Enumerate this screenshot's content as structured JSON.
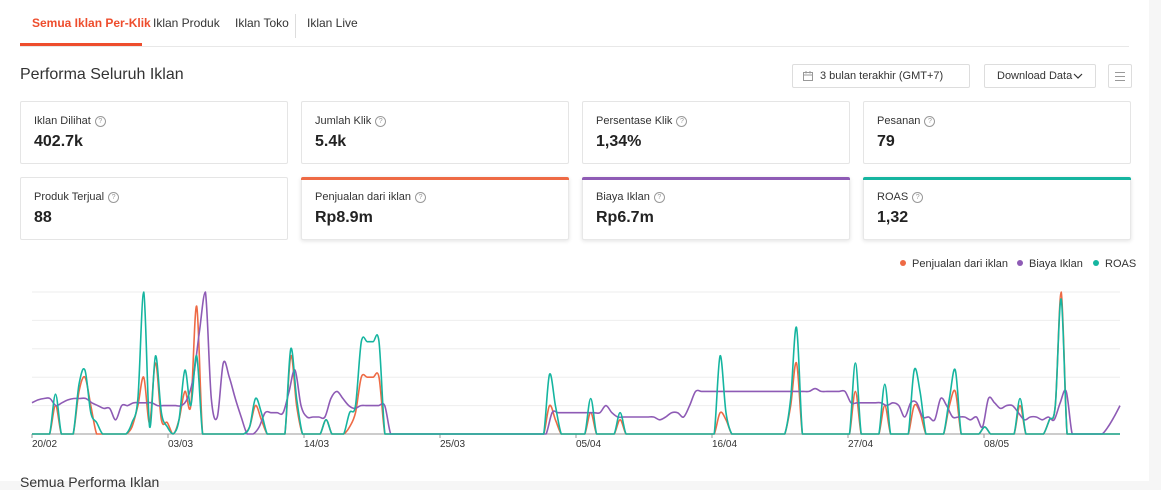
{
  "tabs": [
    {
      "label": "Semua Iklan Per-Klik",
      "active": true
    },
    {
      "label": "Iklan Produk",
      "active": false
    },
    {
      "label": "Iklan Toko",
      "active": false
    },
    {
      "label": "Iklan Live",
      "active": false
    }
  ],
  "header": {
    "title": "Performa Seluruh Iklan",
    "date_range": "3 bulan terakhir (GMT+7)",
    "download_label": "Download Data"
  },
  "metrics": [
    {
      "label": "Iklan Dilihat",
      "value": "402.7k",
      "selected": false
    },
    {
      "label": "Jumlah Klik",
      "value": "5.4k",
      "selected": false
    },
    {
      "label": "Persentase Klik",
      "value": "1,34%",
      "selected": false
    },
    {
      "label": "Pesanan",
      "value": "79",
      "selected": false
    },
    {
      "label": "Produk Terjual",
      "value": "88",
      "selected": false
    },
    {
      "label": "Penjualan dari iklan",
      "value": "Rp8.9m",
      "selected": true,
      "color": "#ee6a45"
    },
    {
      "label": "Biaya Iklan",
      "value": "Rp6.7m",
      "selected": true,
      "color": "#8e5bb5"
    },
    {
      "label": "ROAS",
      "value": "1,32",
      "selected": true,
      "color": "#15b5a0"
    }
  ],
  "legend": [
    {
      "name": "Penjualan dari iklan",
      "color": "#ee6a45"
    },
    {
      "name": "Biaya Iklan",
      "color": "#8e5bb5"
    },
    {
      "name": "ROAS",
      "color": "#15b5a0"
    }
  ],
  "bottom_section_title": "Semua Performa Iklan",
  "chart_data": {
    "type": "line",
    "x_tick_labels": [
      "20/02",
      "03/03",
      "14/03",
      "25/03",
      "05/04",
      "16/04",
      "27/04",
      "08/05"
    ],
    "grid": true,
    "series": [
      {
        "name": "Penjualan dari iklan",
        "color": "#ee6a45",
        "values": [
          0,
          0,
          0,
          0,
          0.2,
          0,
          0,
          0,
          0.3,
          0.4,
          0.2,
          0,
          0,
          0,
          0,
          0,
          0,
          0.05,
          0.2,
          0.4,
          0.08,
          0.5,
          0.1,
          0.08,
          0,
          0.1,
          0.3,
          0.2,
          0.9,
          0,
          0,
          0,
          0,
          0,
          0,
          0,
          0,
          0.05,
          0.2,
          0.1,
          0,
          0,
          0,
          0,
          0.55,
          0.2,
          0,
          0,
          0,
          0,
          0.1,
          0,
          0,
          0,
          0.05,
          0.15,
          0.4,
          0.4,
          0.4,
          0.4,
          0,
          0,
          0,
          0,
          0,
          0,
          0,
          0,
          0,
          0,
          0,
          0,
          0,
          0,
          0,
          0,
          0,
          0,
          0,
          0,
          0,
          0,
          0,
          0,
          0,
          0,
          0,
          0,
          0.2,
          0.1,
          0,
          0,
          0,
          0,
          0,
          0.15,
          0,
          0,
          0,
          0,
          0.1,
          0,
          0,
          0,
          0,
          0,
          0,
          0,
          0,
          0,
          0,
          0,
          0,
          0,
          0,
          0,
          0,
          0.15,
          0.1,
          0,
          0,
          0,
          0,
          0,
          0,
          0,
          0,
          0,
          0,
          0.2,
          0.5,
          0,
          0,
          0,
          0,
          0,
          0,
          0,
          0,
          0,
          0.3,
          0,
          0,
          0,
          0,
          0.2,
          0,
          0,
          0,
          0,
          0.2,
          0.15,
          0,
          0,
          0,
          0,
          0.2,
          0.3,
          0,
          0,
          0,
          0,
          0.05,
          0,
          0,
          0,
          0,
          0,
          0.2,
          0,
          0,
          0,
          0,
          0.1,
          0.2,
          1,
          0,
          0,
          0,
          0,
          0,
          0,
          0,
          0,
          0,
          0
        ]
      },
      {
        "name": "Biaya Iklan",
        "color": "#8e5bb5",
        "values": [
          0.22,
          0.24,
          0.25,
          0.25,
          0.2,
          0.22,
          0.24,
          0.25,
          0.25,
          0.25,
          0.22,
          0.2,
          0.18,
          0.18,
          0.1,
          0.2,
          0.2,
          0.22,
          0.22,
          0.22,
          0.22,
          0.2,
          0.2,
          0.2,
          0.2,
          0.2,
          0.25,
          0.4,
          0.72,
          1,
          0.25,
          0.12,
          0.5,
          0.4,
          0.25,
          0.12,
          0,
          0,
          0.05,
          0.15,
          0.15,
          0.15,
          0.15,
          0.3,
          0.45,
          0.2,
          0.12,
          0.12,
          0.12,
          0.12,
          0.25,
          0.3,
          0.25,
          0.2,
          0.18,
          0.2,
          0.2,
          0.2,
          0.2,
          0.2,
          0,
          0,
          0,
          0,
          0,
          0,
          0,
          0,
          0,
          0,
          0,
          0,
          0,
          0,
          0,
          0,
          0,
          0,
          0,
          0,
          0,
          0,
          0,
          0,
          0,
          0,
          0,
          0.15,
          0.15,
          0.15,
          0.15,
          0.15,
          0.15,
          0.15,
          0.15,
          0.15,
          0.2,
          0.15,
          0.12,
          0.12,
          0.12,
          0.12,
          0.12,
          0.12,
          0.12,
          0.1,
          0.12,
          0.15,
          0.15,
          0.12,
          0.2,
          0.3,
          0.3,
          0.3,
          0.3,
          0.3,
          0.3,
          0.3,
          0.3,
          0.3,
          0.3,
          0.3,
          0.3,
          0.3,
          0.3,
          0.3,
          0.3,
          0.3,
          0.3,
          0.3,
          0.3,
          0.32,
          0.3,
          0.3,
          0.3,
          0.3,
          0.3,
          0.22,
          0.22,
          0.22,
          0.22,
          0.22,
          0.22,
          0.2,
          0.22,
          0.2,
          0.12,
          0.22,
          0.22,
          0.12,
          0.12,
          0.1,
          0.25,
          0.2,
          0.12,
          0.12,
          0.12,
          0.1,
          0.12,
          0.05,
          0.25,
          0.22,
          0.18,
          0.2,
          0.2,
          0.15,
          0.1,
          0.12,
          0.12,
          0.1,
          0.12,
          0.1,
          0.22,
          0.3,
          0,
          0,
          0,
          0,
          0,
          0,
          0.05,
          0.12,
          0.2
        ]
      },
      {
        "name": "ROAS",
        "color": "#15b5a0",
        "values": [
          0,
          0,
          0,
          0,
          0.28,
          0,
          0,
          0,
          0.35,
          0.45,
          0.15,
          0.08,
          0,
          0,
          0,
          0,
          0,
          0.08,
          0.25,
          1,
          0.05,
          0.55,
          0.15,
          0.05,
          0,
          0.1,
          0.45,
          0.2,
          0.55,
          0,
          0,
          0,
          0,
          0,
          0,
          0,
          0,
          0.05,
          0.25,
          0.15,
          0,
          0,
          0,
          0,
          0.6,
          0.25,
          0,
          0,
          0,
          0,
          0.1,
          0,
          0,
          0,
          0.15,
          0.2,
          0.65,
          0.65,
          0.65,
          0.65,
          0,
          0,
          0,
          0,
          0,
          0,
          0,
          0,
          0,
          0,
          0,
          0,
          0,
          0,
          0,
          0,
          0,
          0,
          0,
          0,
          0,
          0,
          0,
          0,
          0,
          0,
          0,
          0,
          0.42,
          0.2,
          0,
          0,
          0,
          0,
          0,
          0.25,
          0,
          0,
          0,
          0,
          0.15,
          0,
          0,
          0,
          0,
          0,
          0,
          0,
          0,
          0,
          0,
          0,
          0,
          0,
          0,
          0,
          0,
          0.55,
          0.15,
          0,
          0,
          0,
          0,
          0,
          0,
          0,
          0,
          0,
          0,
          0.25,
          0.75,
          0,
          0,
          0,
          0,
          0,
          0,
          0,
          0,
          0,
          0.5,
          0,
          0,
          0,
          0,
          0.35,
          0,
          0,
          0,
          0,
          0.45,
          0.3,
          0,
          0,
          0,
          0,
          0.25,
          0.45,
          0,
          0,
          0,
          0,
          0.05,
          0,
          0,
          0,
          0,
          0,
          0.25,
          0,
          0,
          0,
          0,
          0.1,
          0.2,
          0.95,
          0,
          0,
          0,
          0,
          0,
          0,
          0,
          0,
          0,
          0
        ]
      }
    ]
  }
}
